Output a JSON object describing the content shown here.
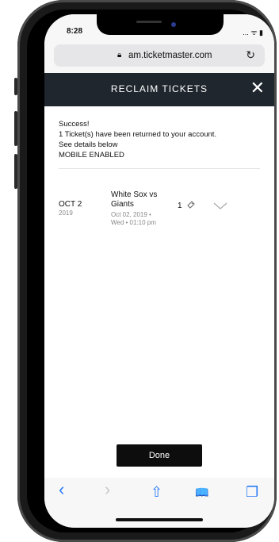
{
  "status": {
    "time": "8:28",
    "signal": "..."
  },
  "browser": {
    "url": "am.ticketmaster.com",
    "lock_icon": "lock-icon",
    "reload_icon": "reload-icon"
  },
  "header": {
    "title": "RECLAIM TICKETS",
    "close_label": "✕"
  },
  "message": {
    "line1": "Success!",
    "line2": "1 Ticket(s) have been returned to your account.",
    "line3": "See details below",
    "line4": "MOBILE ENABLED"
  },
  "event": {
    "date": "OCT 2",
    "year": "2019",
    "title_line1": "White Sox vs",
    "title_line2": "Giants",
    "sub_line1": "Oct 02, 2019 •",
    "sub_line2": "Wed • 01:10 pm",
    "quantity": "1"
  },
  "done_label": "Done",
  "toolbar": {
    "back": "‹",
    "forward": "›",
    "share": "⇧",
    "bookmarks": "📖",
    "tabs": "❐"
  },
  "colors": {
    "header_bg": "#1f262d",
    "accent": "#2a7bf7"
  }
}
